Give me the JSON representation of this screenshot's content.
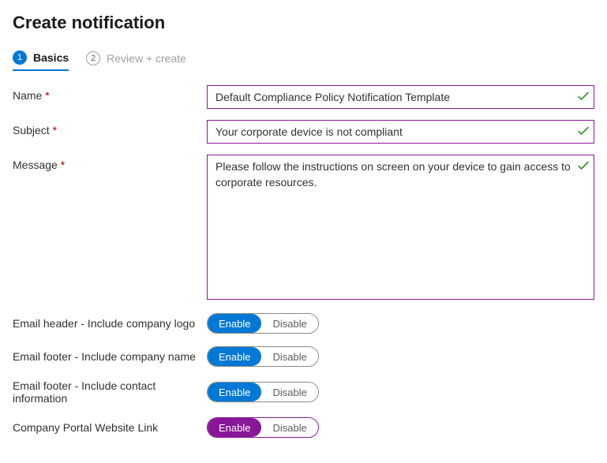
{
  "pageTitle": "Create notification",
  "tabs": [
    {
      "num": "1",
      "label": "Basics",
      "active": true
    },
    {
      "num": "2",
      "label": "Review + create",
      "active": false
    }
  ],
  "fields": {
    "name": {
      "label": "Name",
      "value": "Default Compliance Policy Notification Template"
    },
    "subject": {
      "label": "Subject",
      "value": "Your corporate device is not compliant"
    },
    "message": {
      "label": "Message",
      "value": "Please follow the instructions on screen on your device to gain access to corporate resources."
    }
  },
  "toggles": {
    "enableLabel": "Enable",
    "disableLabel": "Disable",
    "items": [
      {
        "label": "Email header - Include company logo",
        "variant": "blue"
      },
      {
        "label": "Email footer - Include company name",
        "variant": "blue"
      },
      {
        "label": "Email footer - Include contact information",
        "variant": "blue"
      },
      {
        "label": "Company Portal Website Link",
        "variant": "purple"
      }
    ]
  }
}
